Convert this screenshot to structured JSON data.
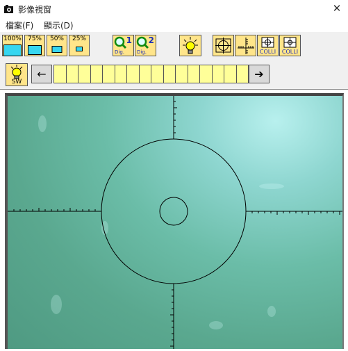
{
  "window": {
    "title": "影像視窗",
    "close_glyph": "✕"
  },
  "menu": {
    "file": "檔案(F)",
    "display": "顯示(D)"
  },
  "zoom_buttons": [
    {
      "label": "100%"
    },
    {
      "label": "75%"
    },
    {
      "label": "50%"
    },
    {
      "label": "25%"
    }
  ],
  "digital_zoom": [
    {
      "num": "1",
      "sub": "Dig."
    },
    {
      "num": "2",
      "sub": "Dig."
    }
  ],
  "colli_label": "COLLI",
  "sw_label": "SW",
  "nav": {
    "prev": "←",
    "next": "➔"
  },
  "thumbnail_cells": 16,
  "colors": {
    "button_bg": "#ffe58a",
    "strip_bg": "#ffff99",
    "zoom_fill": "#36d6f0",
    "icon_blue": "#1c2fb8"
  }
}
